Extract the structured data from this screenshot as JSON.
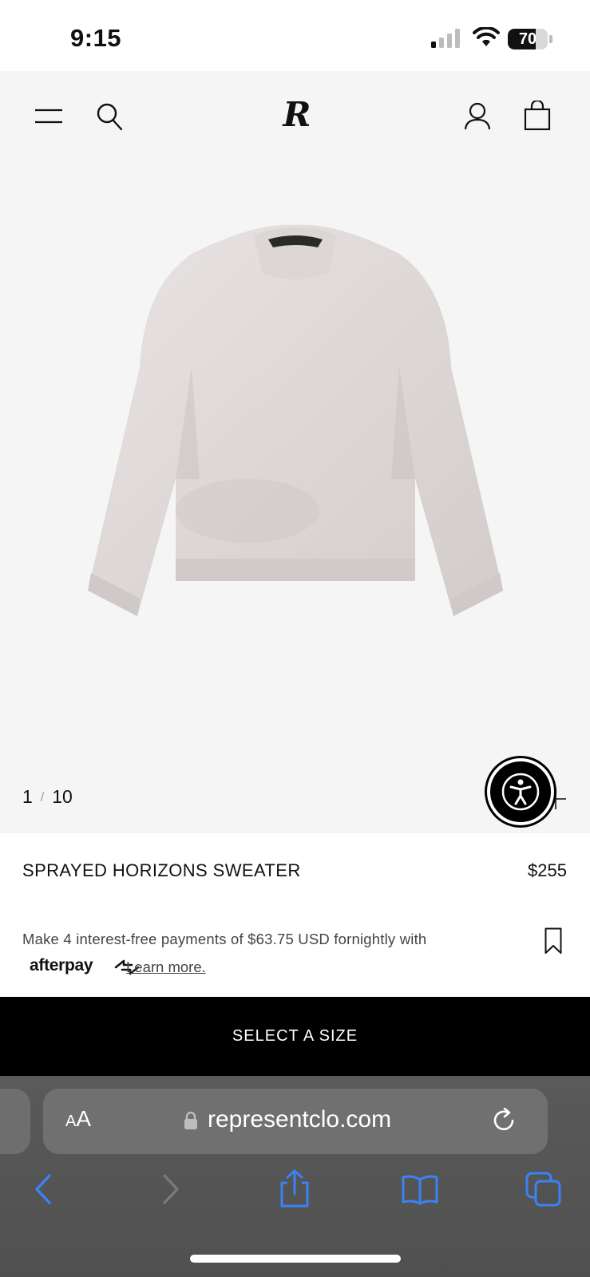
{
  "status_bar": {
    "time": "9:15",
    "battery": "70",
    "battery_level": 0.7
  },
  "header": {
    "logo_text": "R",
    "icons": [
      "menu-icon",
      "search-icon",
      "account-icon",
      "bag-icon"
    ]
  },
  "gallery": {
    "current": "1",
    "separator": "/",
    "total": "10"
  },
  "product": {
    "title": "SPRAYED HORIZONS SWEATER",
    "price": "$255",
    "payment_text": "Make 4 interest-free payments of $63.75 USD fornightly with",
    "afterpay_logo": "afterpay",
    "learn_more": "Learn more."
  },
  "cta": {
    "select_size": "SELECT A SIZE"
  },
  "browser": {
    "aa_small": "A",
    "aa_large": "A",
    "url": "representclo.com",
    "toolbar_icons": [
      "back-icon",
      "forward-icon",
      "share-icon",
      "bookmarks-icon",
      "tabs-icon"
    ]
  },
  "colors": {
    "gallery_bg": "#f5f5f5",
    "cta_bg": "#000000",
    "safari_accent": "#3a82f7"
  }
}
